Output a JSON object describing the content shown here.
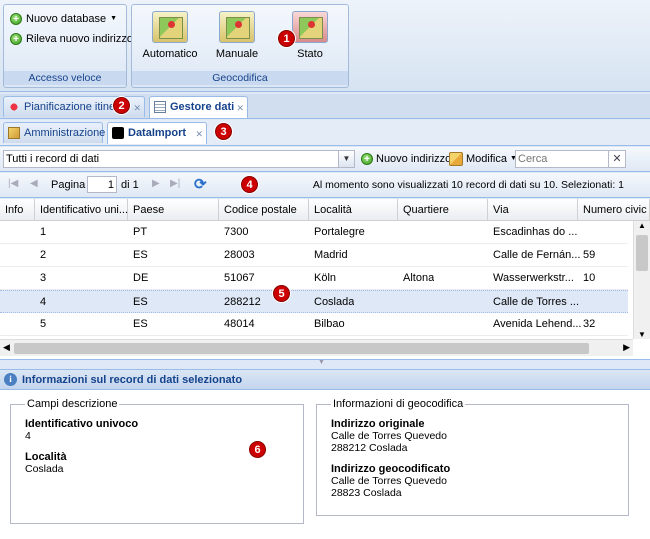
{
  "ribbon": {
    "new_database": "Nuovo database",
    "redetect_address": "Rileva nuovo indirizzo",
    "quick_access_label": "Accesso veloce",
    "automatic": "Automatico",
    "manual": "Manuale",
    "status": "Stato",
    "geocoding_label": "Geocodifica"
  },
  "tabs_top": [
    {
      "label": "Pianificazione itinera"
    },
    {
      "label": "Gestore dati"
    }
  ],
  "tabs_sub": [
    {
      "label": "Amministrazione"
    },
    {
      "label": "DataImport"
    }
  ],
  "toolbar": {
    "filter_value": "Tutti i record di dati",
    "new_address": "Nuovo indirizzo",
    "edit": "Modifica",
    "search_placeholder": "Cerca"
  },
  "pager": {
    "page_label": "Pagina",
    "page_value": "1",
    "of_label": "di 1",
    "status": "Al momento sono visualizzati 10 record di dati su 10. Selezionati: 1"
  },
  "grid": {
    "columns": [
      "Info",
      "Identificativo uni...",
      "Paese",
      "Codice postale",
      "Località",
      "Quartiere",
      "Via",
      "Numero civic"
    ],
    "rows": [
      {
        "status_color": "#5cc44a",
        "id": "1",
        "country": "PT",
        "zip": "7300",
        "city": "Portalegre",
        "district": "",
        "street": "Escadinhas do ...",
        "number": ""
      },
      {
        "status_color": "#5cc44a",
        "id": "2",
        "country": "ES",
        "zip": "28003",
        "city": "Madrid",
        "district": "",
        "street": "Calle de Fernán...",
        "number": "59"
      },
      {
        "status_color": "#4aa8e0",
        "id": "3",
        "country": "DE",
        "zip": "51067",
        "city": "Köln",
        "district": "Altona",
        "street": "Wasserwerkstr...",
        "number": "10"
      },
      {
        "status_color": "#f5c43a",
        "id": "4",
        "country": "ES",
        "zip": "288212",
        "city": "Coslada",
        "district": "",
        "street": "Calle de Torres ...",
        "number": ""
      },
      {
        "status_color": "#5cc44a",
        "id": "5",
        "country": "ES",
        "zip": "48014",
        "city": "Bilbao",
        "district": "",
        "street": "Avenida Lehend...",
        "number": "32"
      }
    ]
  },
  "details": {
    "title": "Informazioni sul record di dati selezionato",
    "desc_legend": "Campi descrizione",
    "id_label": "Identificativo univoco",
    "id_value": "4",
    "city_label": "Località",
    "city_value": "Coslada",
    "geo_legend": "Informazioni di geocodifica",
    "orig_label": "Indirizzo originale",
    "orig_line1": "Calle de Torres Quevedo",
    "orig_line2": "288212 Coslada",
    "geo_label": "Indirizzo geocodificato",
    "geo_line1": "Calle de Torres Quevedo",
    "geo_line2": "28823 Coslada"
  },
  "badges": [
    "1",
    "2",
    "3",
    "4",
    "5",
    "6"
  ]
}
